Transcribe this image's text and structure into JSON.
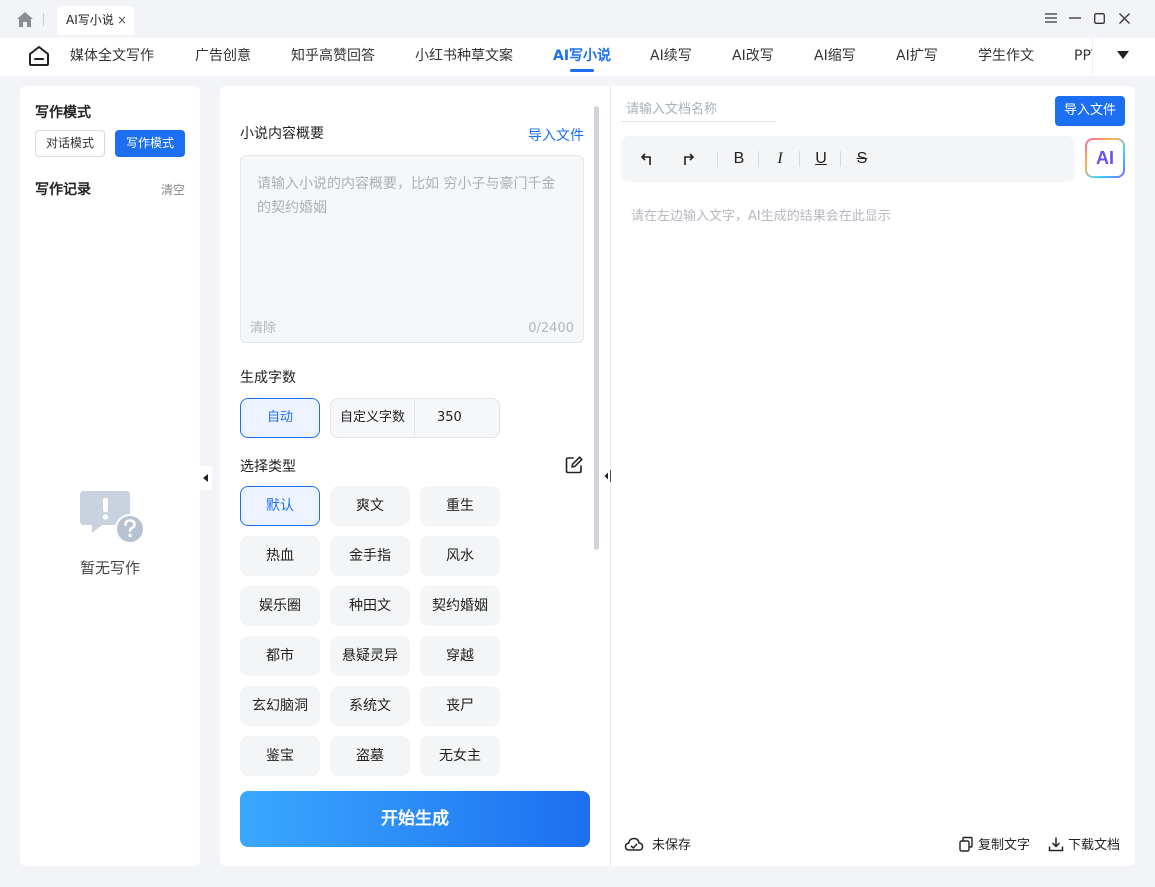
{
  "window": {
    "tab_title": "AI写小说",
    "tab_close": "×"
  },
  "nav": {
    "items": [
      {
        "label": "媒体全文写作"
      },
      {
        "label": "广告创意"
      },
      {
        "label": "知乎高赞回答"
      },
      {
        "label": "小红书种草文案"
      },
      {
        "label": "AI写小说",
        "active": true
      },
      {
        "label": "AI续写"
      },
      {
        "label": "AI改写"
      },
      {
        "label": "AI缩写"
      },
      {
        "label": "AI扩写"
      },
      {
        "label": "学生作文"
      },
      {
        "label": "PPT"
      }
    ]
  },
  "sidebar": {
    "mode_title": "写作模式",
    "mode_chat": "对话模式",
    "mode_write": "写作模式",
    "record_title": "写作记录",
    "clear": "清空",
    "empty_text": "暂无写作"
  },
  "form": {
    "summary_label": "小说内容概要",
    "import_link": "导入文件",
    "summary_placeholder": "请输入小说的内容概要，比如 穷小子与豪门千金的契约婚姻",
    "clear": "清除",
    "counter": "0/2400",
    "words_label": "生成字数",
    "auto": "自动",
    "custom_label": "自定义字数",
    "custom_value": "350",
    "type_label": "选择类型",
    "types": [
      "默认",
      "爽文",
      "重生",
      "热血",
      "金手指",
      "风水",
      "娱乐圈",
      "种田文",
      "契约婚姻",
      "都市",
      "悬疑灵异",
      "穿越",
      "玄幻脑洞",
      "系统文",
      "丧尸",
      "鉴宝",
      "盗墓",
      "无女主"
    ],
    "selected_type": "默认",
    "generate": "开始生成"
  },
  "editor": {
    "doc_name_placeholder": "请输入文档名称",
    "import": "导入文件",
    "toolbar": {
      "bold": "B",
      "italic": "I",
      "underline": "U",
      "strike": "S"
    },
    "ai_label": "AI",
    "placeholder": "请在左边输入文字，AI生成的结果会在此显示",
    "status": "未保存",
    "copy": "复制文字",
    "download": "下载文档"
  }
}
